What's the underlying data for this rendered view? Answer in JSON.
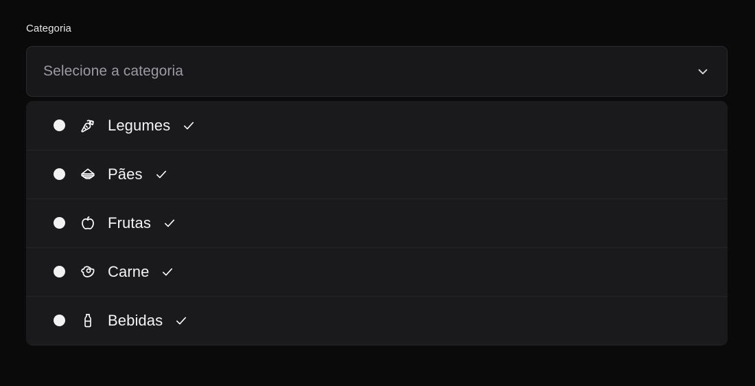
{
  "colors": {
    "page_background": "#0a0a0a",
    "panel_background": "#1a1a1c",
    "select_background": "#18181a",
    "select_border": "#2a2a2d",
    "divider": "#252528",
    "label_text": "#e8e8e8",
    "placeholder_text": "#9b9ba1",
    "option_text": "#f4f4f5",
    "radio_fill": "#f2f2f2",
    "icon_color": "#ffffff"
  },
  "form": {
    "label": "Categoria",
    "select": {
      "placeholder": "Selecione a categoria",
      "value": "",
      "chevron_icon": "chevron-down-icon",
      "expanded": true
    }
  },
  "options": [
    {
      "label": "Legumes",
      "icon": "carrot-icon",
      "radio_icon": "radio-filled-icon",
      "check_icon": "check-icon",
      "selected": false
    },
    {
      "label": "Pães",
      "icon": "bread-icon",
      "radio_icon": "radio-filled-icon",
      "check_icon": "check-icon",
      "selected": false
    },
    {
      "label": "Frutas",
      "icon": "apple-icon",
      "radio_icon": "radio-filled-icon",
      "check_icon": "check-icon",
      "selected": false
    },
    {
      "label": "Carne",
      "icon": "meat-icon",
      "radio_icon": "radio-filled-icon",
      "check_icon": "check-icon",
      "selected": false
    },
    {
      "label": "Bebidas",
      "icon": "bottle-icon",
      "radio_icon": "radio-filled-icon",
      "check_icon": "check-icon",
      "selected": false
    }
  ]
}
